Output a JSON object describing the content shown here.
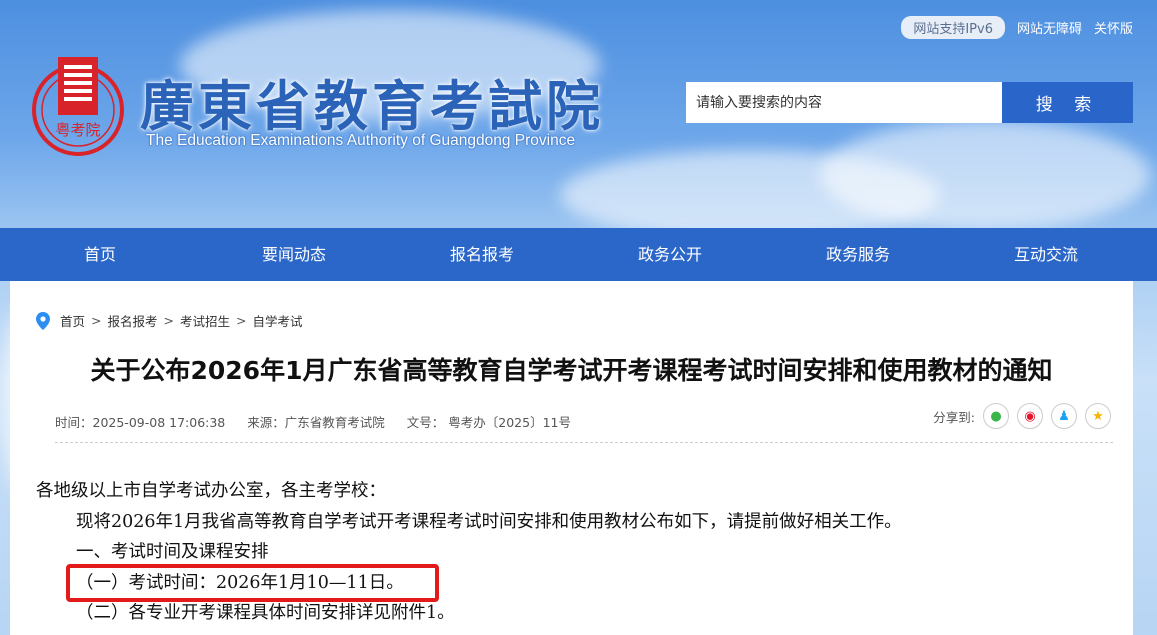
{
  "header": {
    "site_title": "廣東省教育考試院",
    "site_subtitle": "The Education Examinations Authority of Guangdong Province",
    "emblem_text": "粤考院",
    "topbar": {
      "ipv6": "网站支持IPv6",
      "accessibility": "网站无障碍",
      "care": "关怀版"
    },
    "search": {
      "placeholder": "请输入要搜索的内容",
      "button": "搜 索"
    }
  },
  "nav": {
    "items": [
      "首页",
      "要闻动态",
      "报名报考",
      "政务公开",
      "政务服务",
      "互动交流"
    ]
  },
  "breadcrumb": [
    "首页",
    "报名报考",
    "考试招生",
    "自学考试"
  ],
  "article": {
    "title": "关于公布2026年1月广东省高等教育自学考试开考课程考试时间安排和使用教材的通知",
    "meta": {
      "time": "时间：2025-09-08 17:06:38",
      "source": "来源：广东省教育考试院",
      "doc_no": "文号： 粤考办〔2025〕11号"
    },
    "share_label": "分享到:",
    "share_icons": [
      "wechat-icon",
      "weibo-icon",
      "qq-icon",
      "qzone-icon"
    ],
    "paragraphs": [
      "各地级以上市自学考试办公室，各主考学校：",
      "现将2026年1月我省高等教育自学考试开考课程考试时间安排和使用教材公布如下，请提前做好相关工作。",
      "一、考试时间及课程安排",
      "（一）考试时间：2026年1月10—11日。",
      "（二）各专业开考课程具体时间安排详见附件1。"
    ]
  },
  "colors": {
    "nav_bg": "#2b66c9",
    "title_blue": "#2a63b8",
    "highlight_red": "#e21a1a"
  }
}
